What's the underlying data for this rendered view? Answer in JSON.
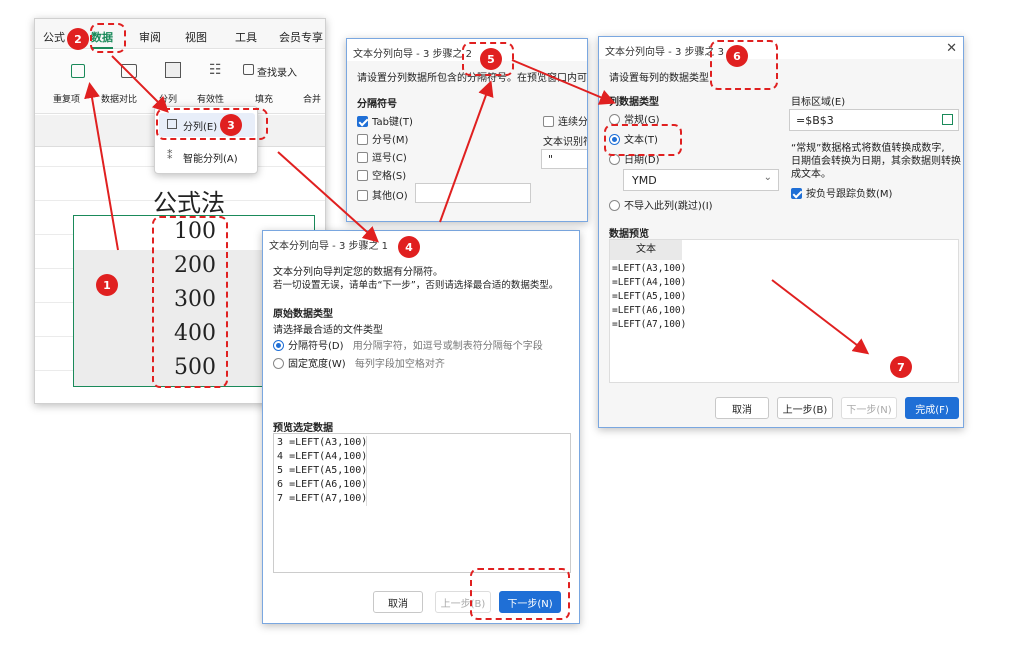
{
  "ribbon": {
    "tabs": [
      "公式",
      "数据",
      "审阅",
      "视图",
      "工具",
      "会员专享"
    ],
    "tools": [
      "重复项",
      "数据对比",
      "分列",
      "有效性",
      "填充",
      "合并"
    ],
    "find_entry": "查找录入",
    "menu_items": [
      "分列(E)",
      "智能分列(A)"
    ]
  },
  "sheet": {
    "heading": "公式法",
    "values": [
      "100",
      "200",
      "300",
      "400",
      "500"
    ]
  },
  "dialog_step1": {
    "title": "文本分列向导 - 3 步骤之 1",
    "desc_line1": "文本分列向导判定您的数据有分隔符。",
    "desc_line2": "若一切设置无误，请单击“下一步”，否则请选择最合适的数据类型。",
    "original_type_label": "原始数据类型",
    "choose_label": "请选择最合适的文件类型",
    "option_delimited": "分隔符号(D)",
    "option_delimited_hint": "用分隔字符，如逗号或制表符分隔每个字段",
    "option_fixed": "固定宽度(W)",
    "option_fixed_hint": "每列字段加空格对齐",
    "preview_label": "预览选定数据",
    "preview_rows": [
      {
        "num": "3",
        "text": "=LEFT(A3,100)"
      },
      {
        "num": "4",
        "text": "=LEFT(A4,100)"
      },
      {
        "num": "5",
        "text": "=LEFT(A5,100)"
      },
      {
        "num": "6",
        "text": "=LEFT(A6,100)"
      },
      {
        "num": "7",
        "text": "=LEFT(A7,100)"
      }
    ],
    "cancel": "取消",
    "prev": "上一步(B)",
    "next": "下一步(N)"
  },
  "dialog_step2": {
    "title": "文本分列向导 - 3 步骤之 2",
    "desc": "请设置分列数据所包含的分隔符号。在预览窗口内可以",
    "delimiters_label": "分隔符号",
    "tab": "Tab键(T)",
    "semicolon": "分号(M)",
    "comma": "逗号(C)",
    "space": "空格(S)",
    "other": "其他(O)",
    "consecutive": "连续分隔",
    "text_qualifier": "文本识别符",
    "qualifier_value": "\""
  },
  "dialog_step3": {
    "title": "文本分列向导 - 3 步骤之 3",
    "desc": "请设置每列的数据类型",
    "col_type_label": "列数据类型",
    "opt_general": "常规(G)",
    "opt_text": "文本(T)",
    "opt_date": "日期(D)",
    "date_format": "YMD",
    "opt_skip": "不导入此列(跳过)(I)",
    "target_label": "目标区域(E)",
    "target_value": "=$B$3",
    "info_line1": "“常规”数据格式将数值转换成数字,",
    "info_line2": "日期值会转换为日期，其余数据则转换",
    "info_line3": "成文本。",
    "negative_check": "按负号跟踪负数(M)",
    "preview_label": "数据预览",
    "preview_header": "文本",
    "preview_rows": [
      "=LEFT(A3,100)",
      "=LEFT(A4,100)",
      "=LEFT(A5,100)",
      "=LEFT(A6,100)",
      "=LEFT(A7,100)"
    ],
    "cancel": "取消",
    "prev": "上一步(B)",
    "next": "下一步(N)",
    "finish": "完成(F)"
  },
  "badges": [
    "1",
    "2",
    "3",
    "4",
    "5",
    "6",
    "7"
  ],
  "colors": {
    "accent": "#1f6fd6",
    "annotation": "#e02020",
    "ribbon_active": "#1a8a5a"
  }
}
